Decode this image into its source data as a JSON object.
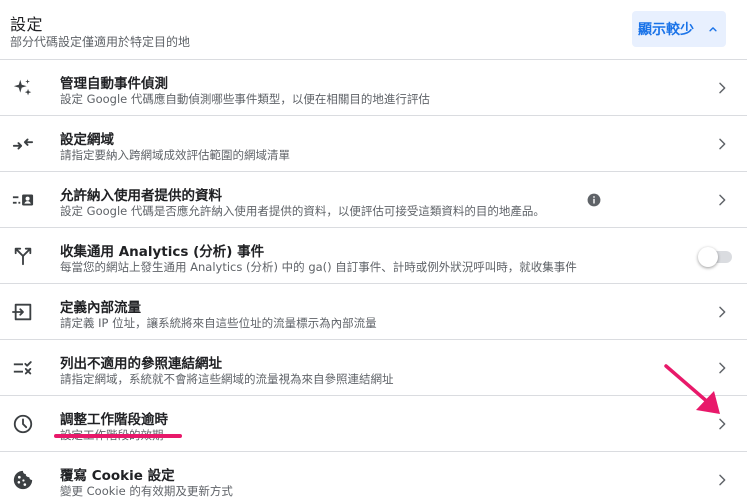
{
  "header": {
    "title": "設定",
    "subtitle": "部分代碼設定僅適用於特定目的地",
    "toggle_label": "顯示較少"
  },
  "rows": [
    {
      "title": "管理自動事件偵測",
      "desc": "設定 Google 代碼應自動偵測哪些事件類型，以便在相關目的地進行評估",
      "icon": "sparkle-icon"
    },
    {
      "title": "設定網域",
      "desc": "請指定要納入跨網域成效評估範圍的網域清單",
      "icon": "merge-arrows-icon"
    },
    {
      "title": "允許納入使用者提供的資料",
      "desc": "設定 Google 代碼是否應允許納入使用者提供的資料，以便評估可接受這類資料的目的地產品。",
      "icon": "contact-card-icon"
    },
    {
      "title": "收集通用 Analytics (分析) 事件",
      "desc": "每當您的網站上發生通用 Analytics (分析) 中的 ga() 自訂事件、計時或例外狀況呼叫時，就收集事件",
      "icon": "fork-icon"
    },
    {
      "title": "定義內部流量",
      "desc": "請定義 IP 位址，讓系統將來自這些位址的流量標示為內部流量",
      "icon": "login-icon"
    },
    {
      "title": "列出不適用的參照連結網址",
      "desc": "請指定網域，系統就不會將這些網域的流量視為來自參照連結網址",
      "icon": "list-exclude-icon"
    },
    {
      "title": "調整工作階段逾時",
      "desc": "設定工作階段的效期",
      "icon": "clock-icon"
    },
    {
      "title": "覆寫 Cookie 設定",
      "desc": "變更 Cookie 的有效期及更新方式",
      "icon": "cookie-icon"
    }
  ],
  "toggle_state": "off",
  "colors": {
    "accent": "#1a73e8",
    "highlight": "#e8196a"
  }
}
